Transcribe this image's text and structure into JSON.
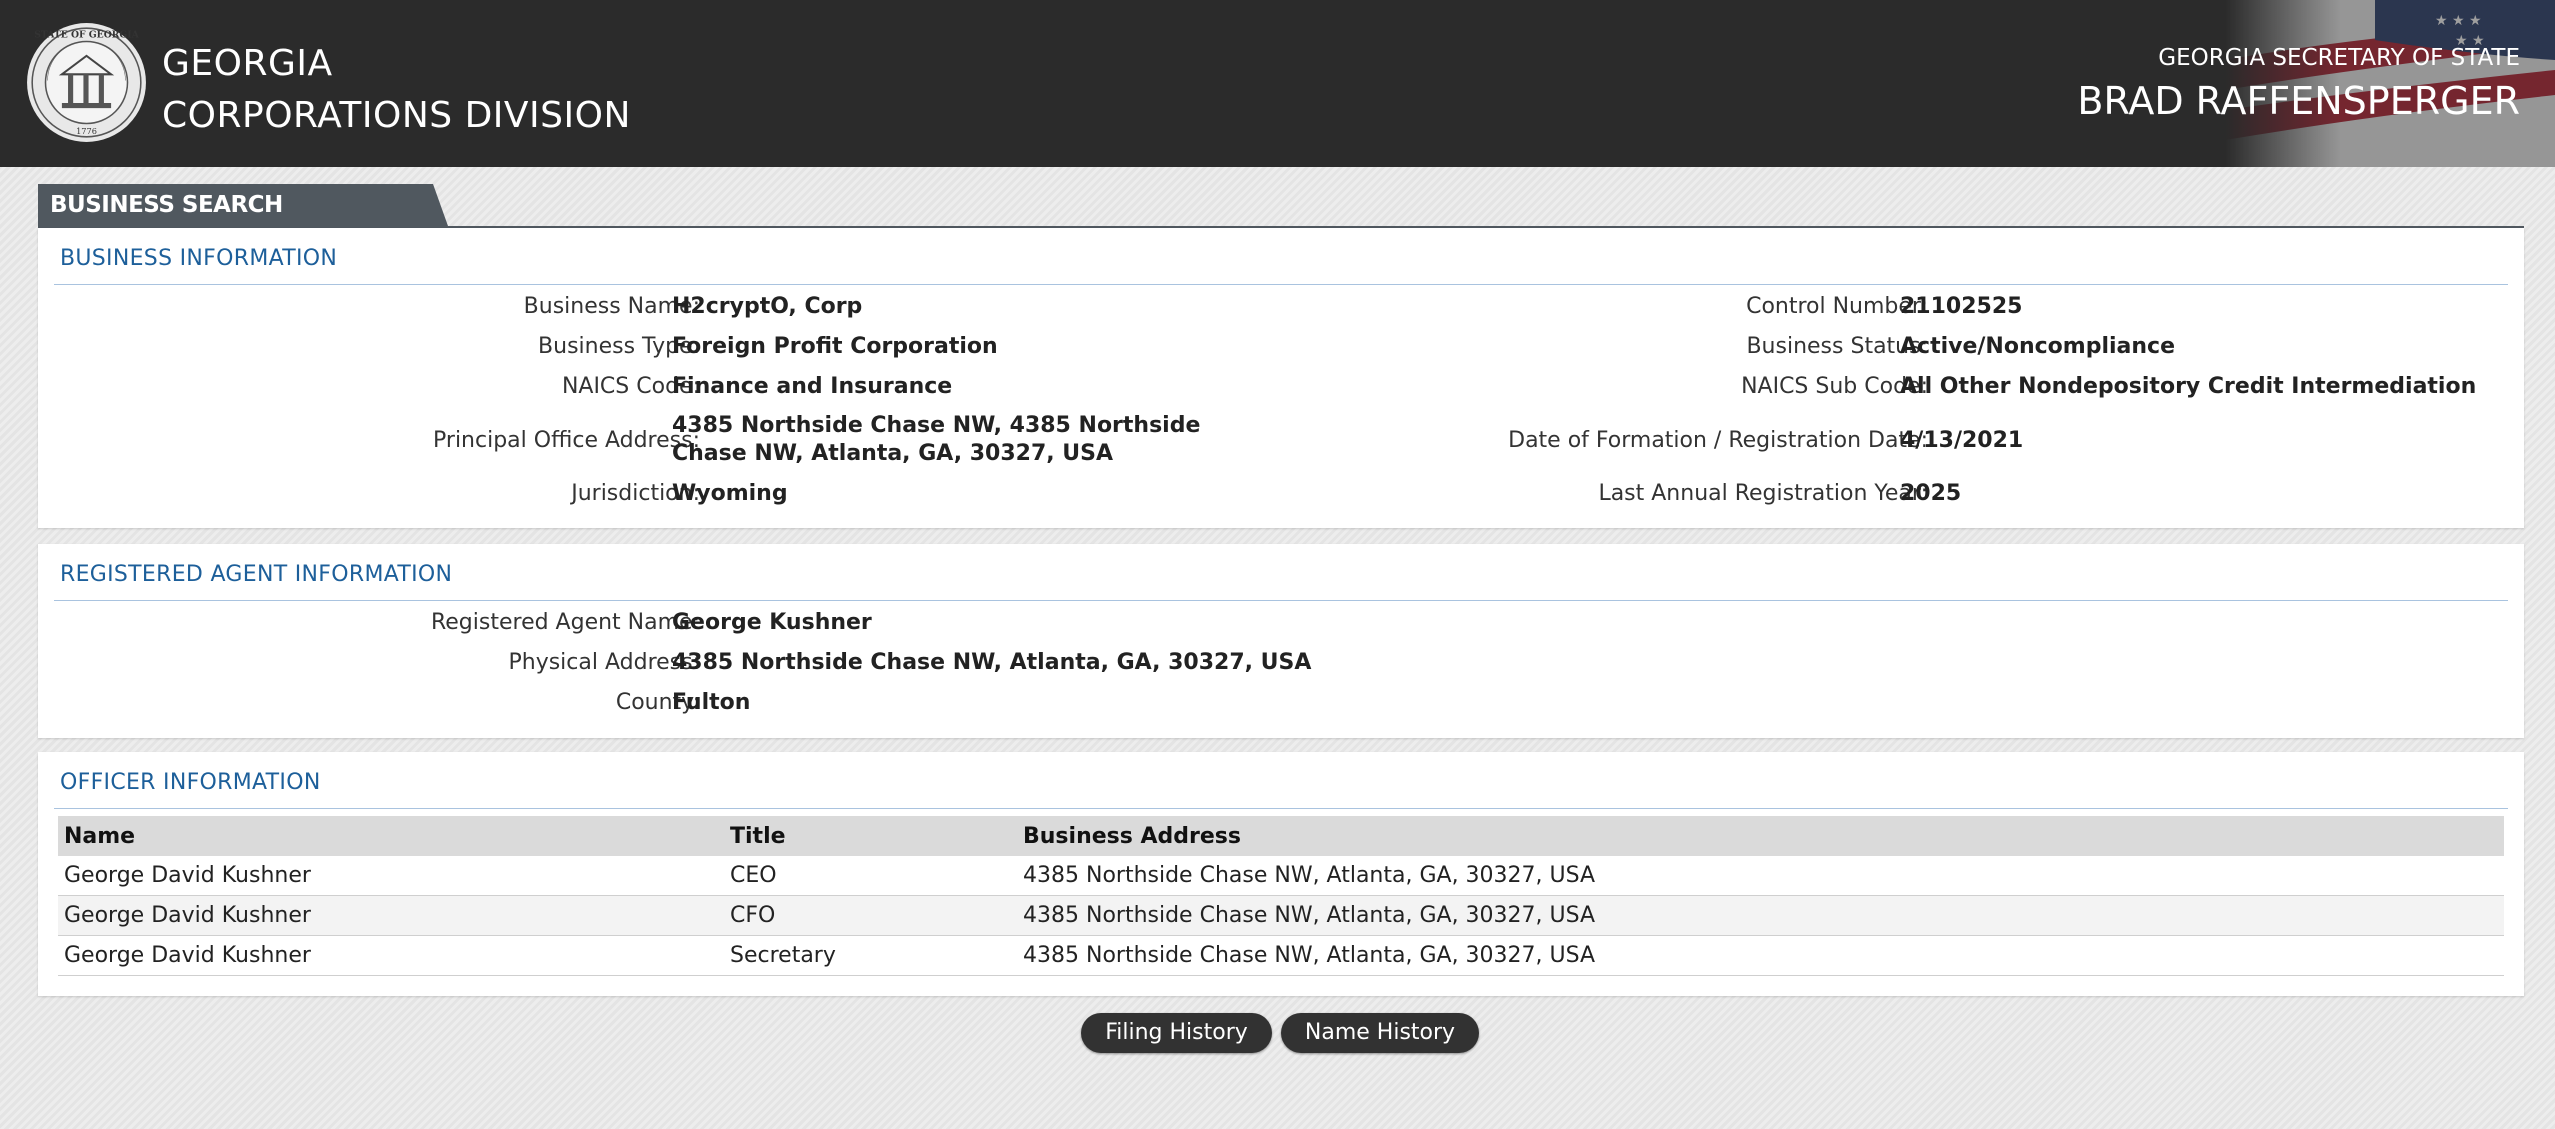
{
  "header": {
    "seal_text_top": "STATE OF GEORGIA",
    "seal_year": "1776",
    "division_line1": "GEORGIA",
    "division_line2": "CORPORATIONS DIVISION",
    "sos_line1": "GEORGIA SECRETARY OF STATE",
    "sos_line2": "BRAD RAFFENSPERGER"
  },
  "tab": {
    "label": "BUSINESS SEARCH"
  },
  "business_info": {
    "title": "BUSINESS INFORMATION",
    "left": [
      {
        "label": "Business Name:",
        "value": "H2cryptO, Corp"
      },
      {
        "label": "Business Type:",
        "value": "Foreign Profit Corporation"
      },
      {
        "label": "NAICS Code:",
        "value": "Finance and Insurance"
      },
      {
        "label": "Principal Office Address:",
        "value": "4385 Northside Chase NW, 4385 Northside Chase NW, Atlanta, GA, 30327, USA"
      },
      {
        "label": "Jurisdiction:",
        "value": "Wyoming"
      }
    ],
    "right": [
      {
        "label": "Control Number:",
        "value": "21102525"
      },
      {
        "label": "Business Status:",
        "value": "Active/Noncompliance"
      },
      {
        "label": "NAICS Sub Code:",
        "value": "All Other Nondepository Credit Intermediation"
      },
      {
        "label": "Date of Formation / Registration Date:",
        "value": "4/13/2021"
      },
      {
        "label": "Last Annual Registration Year:",
        "value": "2025"
      }
    ]
  },
  "agent_info": {
    "title": "REGISTERED AGENT INFORMATION",
    "rows": [
      {
        "label": "Registered Agent Name:",
        "value": "George Kushner"
      },
      {
        "label": "Physical Address:",
        "value": "4385 Northside Chase NW, Atlanta, GA, 30327, USA"
      },
      {
        "label": "County:",
        "value": "Fulton"
      }
    ]
  },
  "officer_info": {
    "title": "OFFICER INFORMATION",
    "columns": [
      "Name",
      "Title",
      "Business Address"
    ],
    "rows": [
      [
        "George David Kushner",
        "CEO",
        "4385 Northside Chase NW, Atlanta, GA, 30327, USA"
      ],
      [
        "George David Kushner",
        "CFO",
        "4385 Northside Chase NW, Atlanta, GA, 30327, USA"
      ],
      [
        "George David Kushner",
        "Secretary",
        "4385 Northside Chase NW, Atlanta, GA, 30327, USA"
      ]
    ]
  },
  "buttons": {
    "filing_history": "Filing History",
    "name_history": "Name History"
  }
}
